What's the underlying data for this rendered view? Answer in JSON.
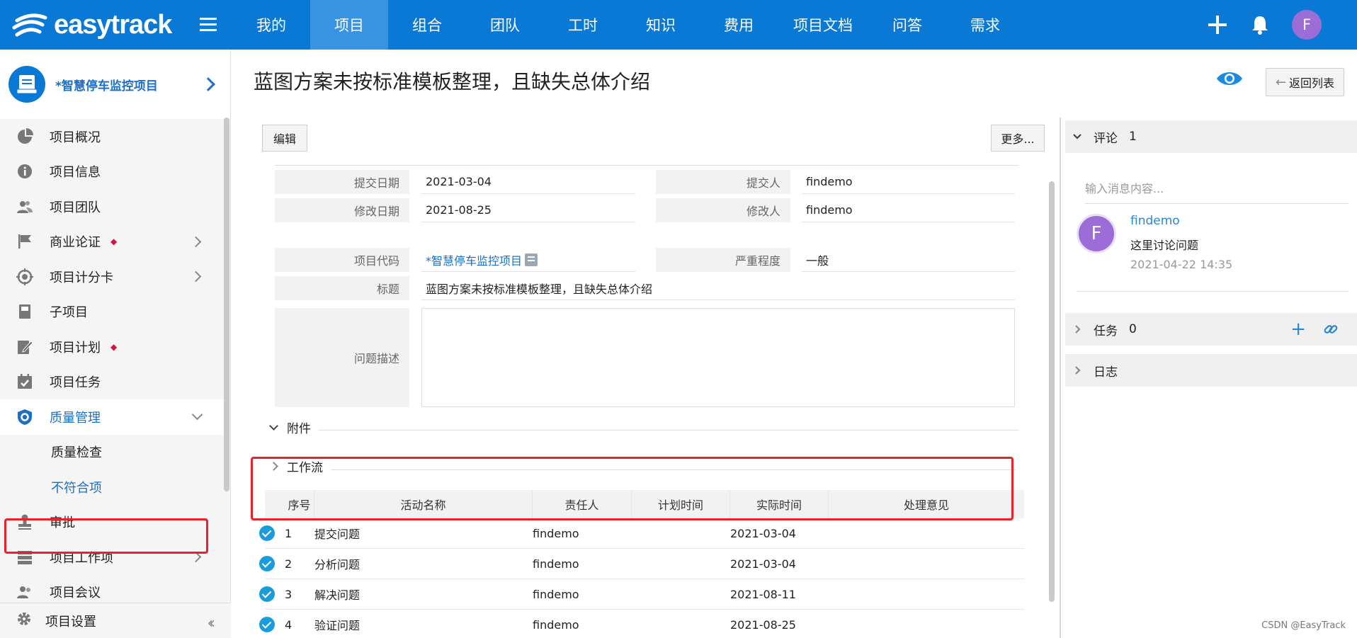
{
  "app": {
    "logo_text": "easytrack"
  },
  "nav": {
    "items": [
      "我的",
      "项目",
      "组合",
      "团队",
      "工时",
      "知识",
      "费用",
      "项目文档",
      "问答",
      "需求"
    ],
    "active_index": 1
  },
  "user": {
    "initial": "F"
  },
  "sidebar": {
    "project_name": "*智慧停车监控项目",
    "items": [
      {
        "label": "项目概况",
        "icon": "pie-chart-icon"
      },
      {
        "label": "项目信息",
        "icon": "info-icon"
      },
      {
        "label": "项目团队",
        "icon": "team-icon"
      },
      {
        "label": "商业论证",
        "icon": "flag-icon",
        "dot": "◆",
        "has_children": true
      },
      {
        "label": "项目计分卡",
        "icon": "target-icon",
        "has_children": true
      },
      {
        "label": "子项目",
        "icon": "book-icon"
      },
      {
        "label": "项目计划",
        "icon": "plan-icon",
        "dot": "◆"
      },
      {
        "label": "项目任务",
        "icon": "calendar-check-icon"
      },
      {
        "label": "质量管理",
        "icon": "shield-icon",
        "expanded": true
      },
      {
        "label": "质量检查",
        "sub": true
      },
      {
        "label": "不符合项",
        "sub": true,
        "current": true
      },
      {
        "label": "审批",
        "icon": "stamp-icon"
      },
      {
        "label": "项目工作项",
        "icon": "list-icon",
        "has_children": true
      },
      {
        "label": "项目会议",
        "icon": "meeting-icon"
      }
    ],
    "footer_label": "项目设置"
  },
  "main": {
    "title": "蓝图方案未按标准模板整理，且缺失总体介绍",
    "back_label": "返回列表",
    "edit_label": "编辑",
    "more_label": "更多...",
    "fields": {
      "submit_date_label": "提交日期",
      "submit_date": "2021-03-04",
      "submitter_label": "提交人",
      "submitter": "findemo",
      "modify_date_label": "修改日期",
      "modify_date": "2021-08-25",
      "modifier_label": "修改人",
      "modifier": "findemo",
      "project_code_label": "项目代码",
      "project_code": "*智慧停车监控项目",
      "severity_label": "严重程度",
      "severity": "一般",
      "title_label": "标题",
      "title": "蓝图方案未按标准模板整理，且缺失总体介绍",
      "desc_label": "问题描述"
    },
    "attachments_label": "附件",
    "workflow_label": "工作流",
    "workflow": {
      "headers": [
        "序号",
        "活动名称",
        "责任人",
        "计划时间",
        "实际时间",
        "处理意见"
      ],
      "rows": [
        {
          "no": "1",
          "activity": "提交问题",
          "owner": "findemo",
          "planned": "",
          "actual": "2021-03-04",
          "opinion": ""
        },
        {
          "no": "2",
          "activity": "分析问题",
          "owner": "findemo",
          "planned": "",
          "actual": "2021-03-04",
          "opinion": ""
        },
        {
          "no": "3",
          "activity": "解决问题",
          "owner": "findemo",
          "planned": "",
          "actual": "2021-08-11",
          "opinion": ""
        },
        {
          "no": "4",
          "activity": "验证问题",
          "owner": "findemo",
          "planned": "",
          "actual": "2021-08-25",
          "opinion": ""
        }
      ]
    }
  },
  "right_panel": {
    "comments_label": "评论",
    "comments_count": "1",
    "input_placeholder": "输入消息内容...",
    "comment": {
      "initial": "F",
      "user": "findemo",
      "text": "这里讨论问题",
      "time": "2021-04-22 14:35"
    },
    "tasks_label": "任务",
    "tasks_count": "0",
    "log_label": "日志"
  },
  "watermark": "CSDN @EasyTrack",
  "colors": {
    "brand": "#0a79d6",
    "highlight_box": "#e8222a",
    "avatar": "#9c6dd7"
  }
}
